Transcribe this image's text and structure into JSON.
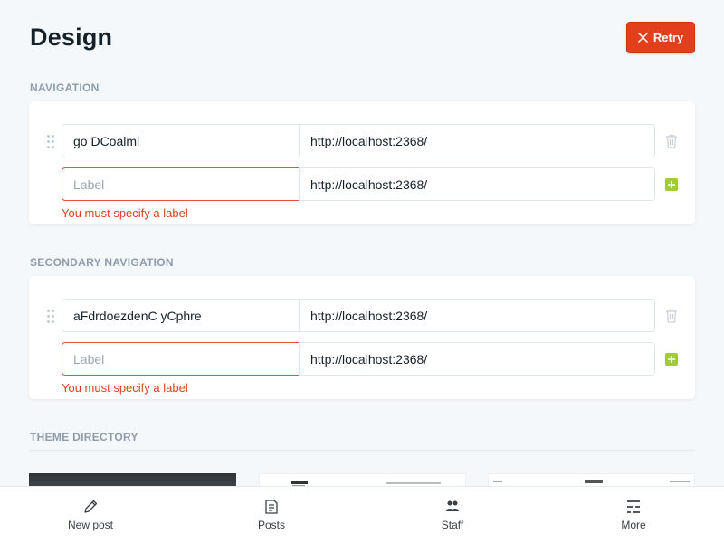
{
  "header": {
    "title": "Design",
    "retry_label": "Retry"
  },
  "colors": {
    "accent_error": "#e2401c",
    "add_green": "#9fcd35",
    "section_gray": "#8e9cac"
  },
  "navigation": {
    "title": "NAVIGATION",
    "items": [
      {
        "label": "go DCoalml",
        "url": "http://localhost:2368/"
      }
    ],
    "new_item": {
      "label_placeholder": "Label",
      "url": "http://localhost:2368/",
      "error": "You must specify a label"
    }
  },
  "secondary_navigation": {
    "title": "SECONDARY NAVIGATION",
    "items": [
      {
        "label": "aFdrdoezdenC yCphre",
        "url": "http://localhost:2368/"
      }
    ],
    "new_item": {
      "label_placeholder": "Label",
      "url": "http://localhost:2368/",
      "error": "You must specify a label"
    }
  },
  "theme_directory": {
    "title": "THEME DIRECTORY"
  },
  "bottom_nav": [
    {
      "label": "New post",
      "icon": "pencil-icon"
    },
    {
      "label": "Posts",
      "icon": "posts-icon"
    },
    {
      "label": "Staff",
      "icon": "staff-icon"
    },
    {
      "label": "More",
      "icon": "more-icon"
    }
  ]
}
